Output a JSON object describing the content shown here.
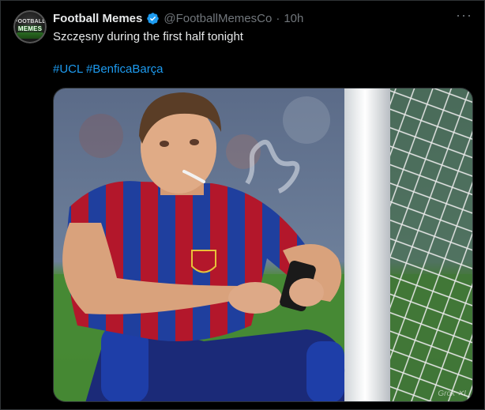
{
  "tweet": {
    "author_name": "Football Memes",
    "handle": "@FootballMemesCo",
    "separator": "·",
    "time": "10h",
    "more_label": "···",
    "text": "Szczęsny during the first half tonight",
    "hashtags": [
      "#UCL",
      "#BenficaBarça"
    ],
    "avatar": {
      "line1": "FOOTBALL",
      "line2": "MEMES"
    },
    "verified_icon": "verified-badge-icon",
    "media": {
      "description_icon": "photo",
      "watermark": "Grok ✕I"
    }
  },
  "colors": {
    "background": "#000000",
    "text": "#e7e9ea",
    "secondary": "#71767b",
    "link": "#1d9bf0",
    "border": "#2f3336"
  }
}
